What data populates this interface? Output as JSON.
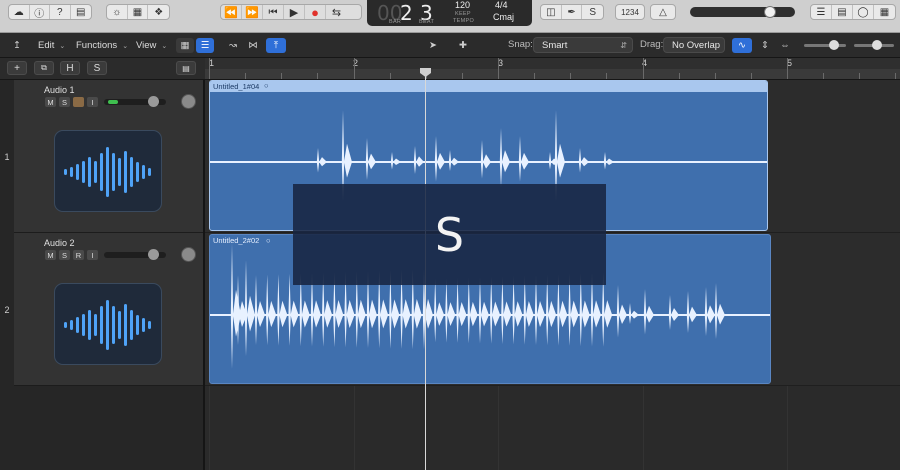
{
  "lcd": {
    "bar_dim": "00",
    "bar": "2",
    "beat": "3",
    "bar_label": "BAR",
    "beat_label": "BEAT",
    "tempo": "120",
    "tempo_label": "KEEP",
    "tempo_sub": "TEMPO",
    "time_signature": "4/4",
    "key": "Cmaj"
  },
  "controlbar": {
    "count_in": "1234",
    "master_volume": 0.8
  },
  "toolbar": {
    "edit_label": "Edit",
    "functions_label": "Functions",
    "view_label": "View",
    "snap_label": "Snap:",
    "snap_value": "Smart",
    "drag_label": "Drag:",
    "drag_value": "No Overlap"
  },
  "track_header": {
    "add_label": "+",
    "h_label": "H",
    "s_label": "S"
  },
  "ruler": {
    "bars": [
      "1",
      "2",
      "3",
      "4",
      "5"
    ]
  },
  "tracks": [
    {
      "number": "1",
      "name": "Audio 1",
      "buttons": [
        "M",
        "S",
        "",
        "I"
      ],
      "volume": 0.8,
      "region_name": "Untitled_1#04"
    },
    {
      "number": "2",
      "name": "Audio 2",
      "buttons": [
        "M",
        "S",
        "R",
        "I"
      ],
      "volume": 0.8,
      "region_name": "Untitled_2#02"
    }
  ],
  "overlay": {
    "text": "S"
  },
  "colors": {
    "region": "#3f6fad",
    "region_header": "#a9c7ee",
    "waveform": "#e8f1ff",
    "record": "#e0312b",
    "accent_blue": "#3b82f6"
  }
}
